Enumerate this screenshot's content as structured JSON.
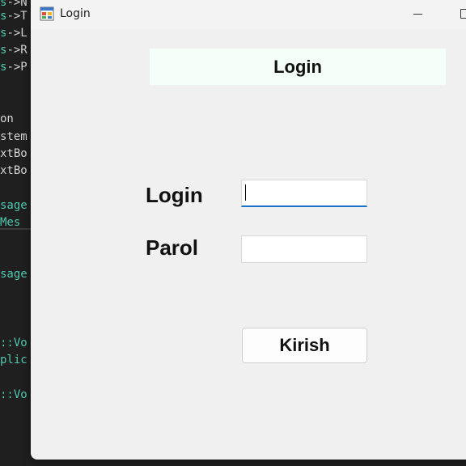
{
  "background_editor": {
    "lines": [
      {
        "prefix": "s",
        "arrow": "->",
        "rest": "N"
      },
      {
        "prefix": "s",
        "arrow": "->",
        "rest": "T"
      },
      {
        "prefix": "s",
        "arrow": "->",
        "rest": "L"
      },
      {
        "prefix": "s",
        "arrow": "->",
        "rest": "R"
      },
      {
        "prefix": "s",
        "arrow": "->",
        "rest": "P"
      },
      {
        "text": "on"
      },
      {
        "text": "stem"
      },
      {
        "text": "xtBo"
      },
      {
        "text": "xtBo"
      },
      {
        "text": "sage"
      },
      {
        "text": " Mes"
      },
      {
        "text": "sage"
      },
      {
        "text": "::Vo"
      },
      {
        "text": "plic"
      },
      {
        "text": "::Vo"
      }
    ]
  },
  "window": {
    "title": "Login",
    "icon": "winforms-app-icon",
    "controls": [
      "minimize-icon",
      "maximize-icon"
    ]
  },
  "form": {
    "header": "Login",
    "login_label": "Login",
    "login_value": "",
    "parol_label": "Parol",
    "parol_value": "",
    "submit_label": "Kirish"
  },
  "colors": {
    "window_bg": "#f0f0f0",
    "header_bg": "#f5fff9",
    "focus_accent": "#1a73c9"
  }
}
